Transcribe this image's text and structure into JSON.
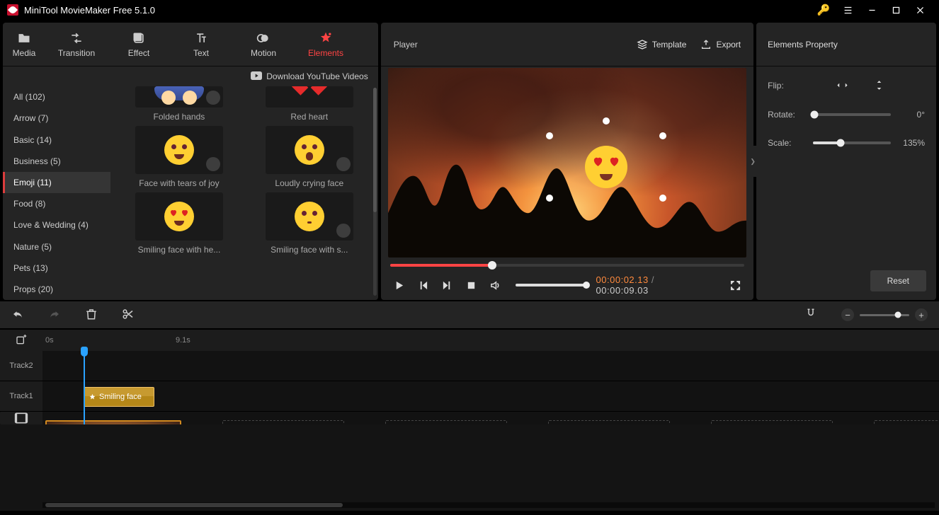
{
  "app_title": "MiniTool MovieMaker Free 5.1.0",
  "topnav": [
    {
      "label": "Media"
    },
    {
      "label": "Transition"
    },
    {
      "label": "Effect"
    },
    {
      "label": "Text"
    },
    {
      "label": "Motion"
    },
    {
      "label": "Elements"
    }
  ],
  "topnav_active": 5,
  "download_label": "Download YouTube Videos",
  "categories": [
    "All (102)",
    "Arrow (7)",
    "Basic (14)",
    "Business (5)",
    "Emoji (11)",
    "Food (8)",
    "Love & Wedding (4)",
    "Nature (5)",
    "Pets (13)",
    "Props (20)"
  ],
  "categories_active": 4,
  "thumbs": [
    {
      "label": "Folded hands"
    },
    {
      "label": "Red heart"
    },
    {
      "label": "Face with tears of joy"
    },
    {
      "label": "Loudly crying face"
    },
    {
      "label": "Smiling face with he..."
    },
    {
      "label": "Smiling face with s..."
    }
  ],
  "player_label": "Player",
  "template_label": "Template",
  "export_label": "Export",
  "time_current": "00:00:02.13",
  "time_total": "00:00:09.03",
  "seek_percent": 29,
  "properties": {
    "title": "Elements Property",
    "flip_label": "Flip:",
    "rotate_label": "Rotate:",
    "rotate_value": "0°",
    "rotate_percent": 0,
    "scale_label": "Scale:",
    "scale_value": "135%",
    "scale_percent": 35,
    "reset_label": "Reset"
  },
  "ruler": {
    "t0": "0s",
    "t1": "9.1s"
  },
  "tracks": {
    "t2": "Track2",
    "t1": "Track1"
  },
  "clip_label": "Smiling face"
}
